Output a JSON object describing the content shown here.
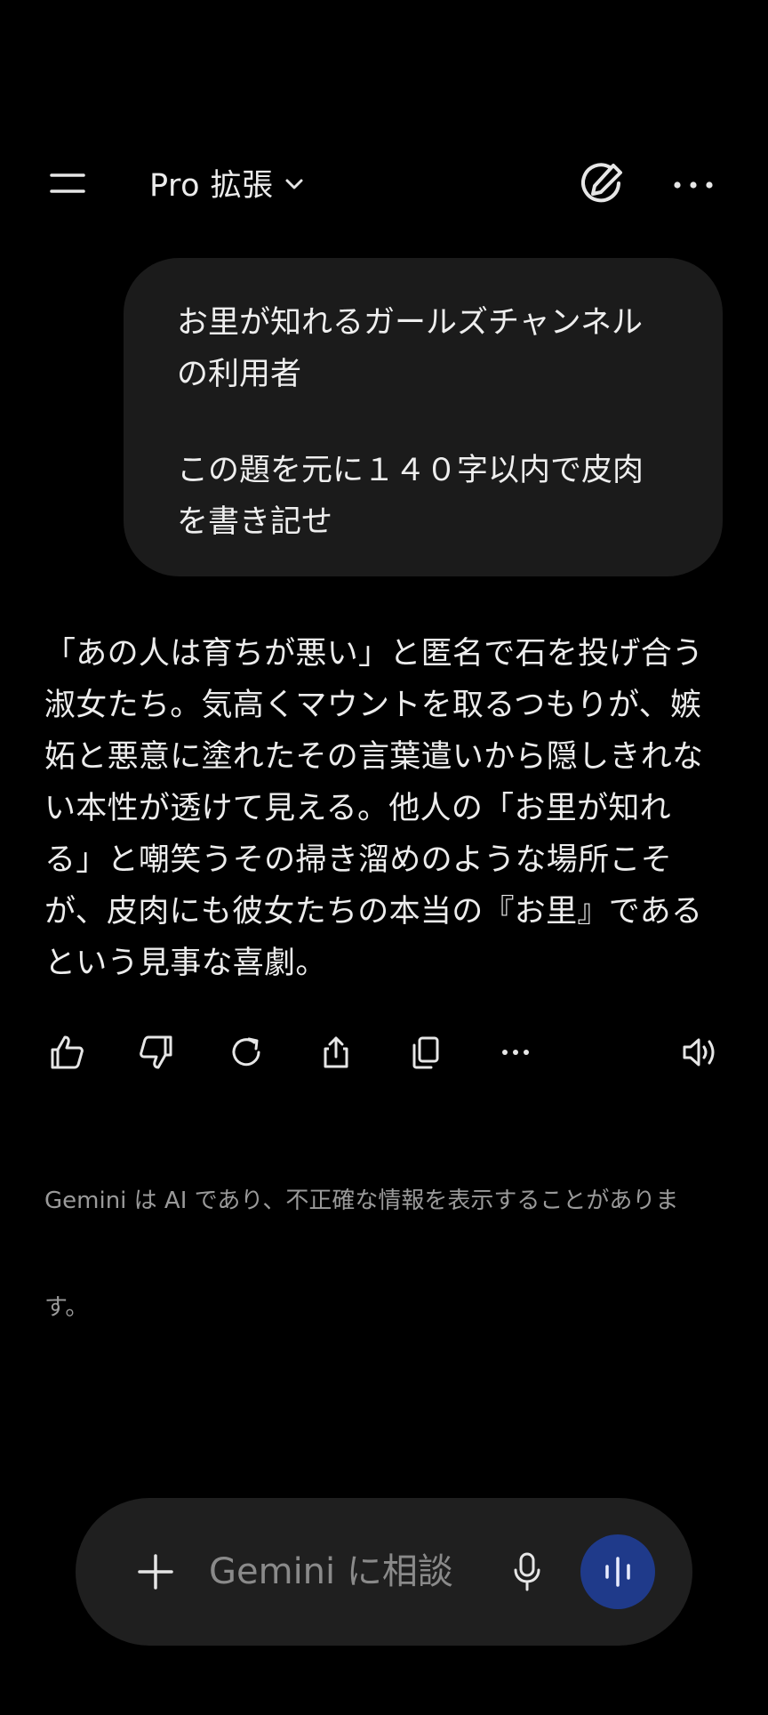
{
  "header": {
    "model_label": "Pro 拡張",
    "icons": {
      "menu": "menu-icon",
      "chevron": "chevron-down-icon",
      "new_chat": "edit-icon",
      "more": "more-horizontal-icon"
    }
  },
  "conversation": {
    "user_message": {
      "lines": [
        "お里が知れるガールズチャンネル",
        "の利用者",
        "",
        "この題を元に１４０字以内で皮肉",
        "を書き記せ"
      ]
    },
    "model_response": {
      "lines": [
        "「あの人は育ちが悪い」と匿名で石を投げ合う",
        "淑女たち。気高くマウントを取るつもりが、嫉",
        "妬と悪意に塗れたその言葉遣いから隠しきれな",
        "い本性が透けて見える。他人の「お里が知れ",
        "る」と嘲笑うその掃き溜めのような場所こそ",
        "が、皮肉にも彼女たちの本当の『お里』である",
        "という見事な喜劇。"
      ]
    }
  },
  "response_actions": [
    {
      "icon": "thumbs-up-icon"
    },
    {
      "icon": "thumbs-down-icon"
    },
    {
      "icon": "regenerate-icon"
    },
    {
      "icon": "share-icon"
    },
    {
      "icon": "copy-icon"
    },
    {
      "icon": "more-horizontal-icon"
    },
    {
      "icon": "speaker-icon"
    }
  ],
  "disclaimer": {
    "lines": [
      "Gemini は AI であり、不正確な情報を表示することがありま",
      "す。"
    ]
  },
  "composer": {
    "placeholder": "Gemini に相談",
    "icons": {
      "add": "plus-icon",
      "mic": "microphone-icon",
      "live": "live-waveform-icon"
    }
  },
  "colors": {
    "background": "#000000",
    "bubble": "#1b1b1b",
    "composer": "#1f1f1f",
    "live_button": "#1f3a8a",
    "text": "#ececec",
    "muted_text": "#9a9a9a"
  }
}
